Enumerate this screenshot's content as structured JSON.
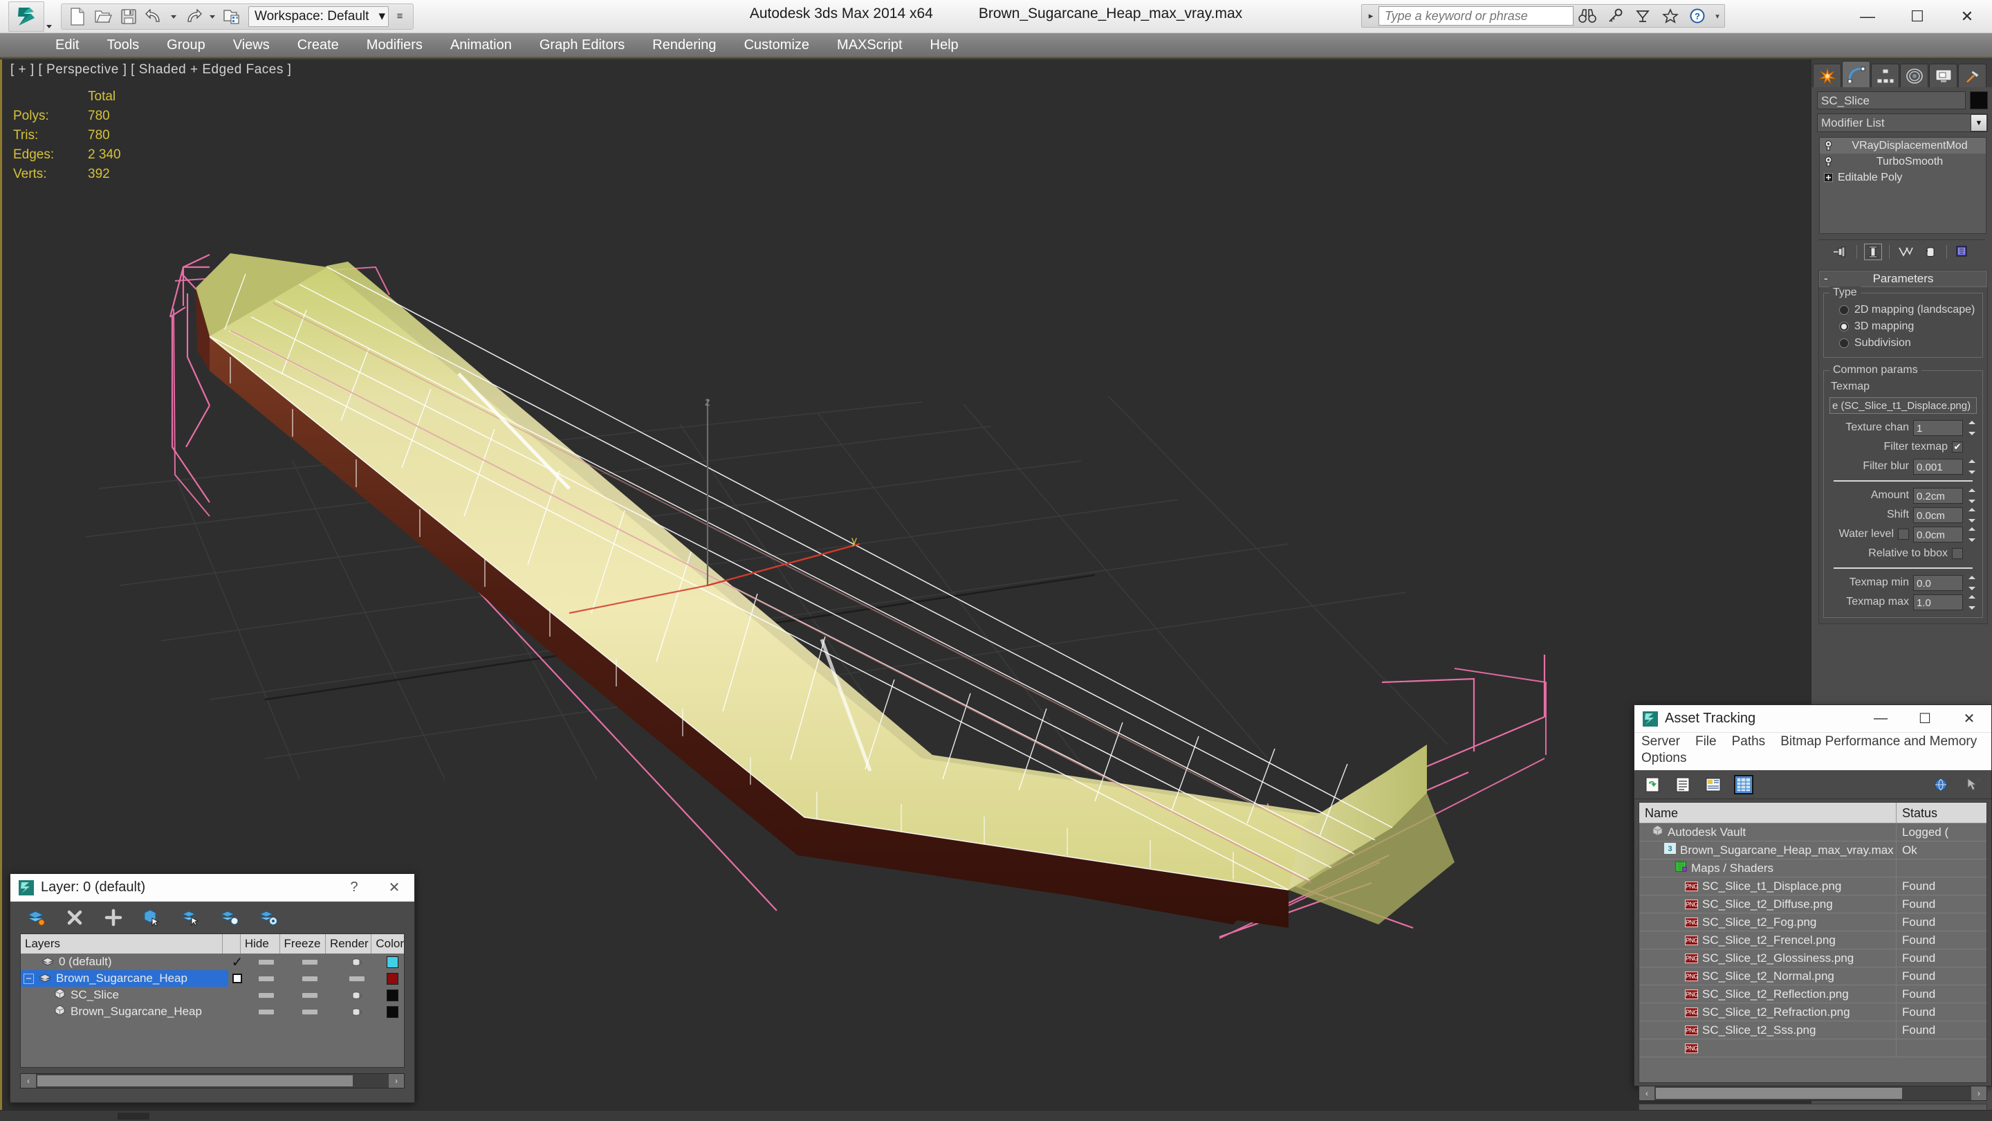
{
  "app": {
    "title": "Autodesk 3ds Max  2014 x64",
    "filename": "Brown_Sugarcane_Heap_max_vray.max",
    "logo_icon": "3dsmax-logo-icon"
  },
  "quick_access": {
    "new_label": "new-file",
    "open_label": "open-file",
    "save_label": "save-file",
    "undo_label": "undo",
    "redo_label": "redo",
    "setproject_label": "set-project-folder",
    "workspace_label": "Workspace: Default",
    "workspace_caret": "▾",
    "more_caret": "≡"
  },
  "search": {
    "placeholder": "Type a keyword or phrase",
    "value": "",
    "arrow": "▸",
    "icons": [
      "binoculars-icon",
      "key-icon",
      "satellite-dish-icon",
      "star-icon",
      "help-icon"
    ],
    "help_caret": "▾"
  },
  "window_controls": {
    "minimize": "—",
    "maximize": "☐",
    "close": "✕"
  },
  "menu": {
    "items": [
      "Edit",
      "Tools",
      "Group",
      "Views",
      "Create",
      "Modifiers",
      "Animation",
      "Graph Editors",
      "Rendering",
      "Customize",
      "MAXScript",
      "Help"
    ]
  },
  "viewport": {
    "label": "[ + ] [ Perspective ] [ Shaded + Edged Faces ]",
    "stats": {
      "header": "Total",
      "rows": [
        {
          "label": "Polys:",
          "value": "780"
        },
        {
          "label": "Tris:",
          "value": "780"
        },
        {
          "label": "Edges:",
          "value": "2 340"
        },
        {
          "label": "Verts:",
          "value": "392"
        }
      ]
    },
    "colors": {
      "background": "#2e2e2e",
      "grid": "#3d3d3d",
      "selection_bracket": "#e86fa6",
      "mesh_top": "#e8e0a0",
      "mesh_side": "#5a2418",
      "wireframe": "#ffffff",
      "axis_x": "#d33a2c",
      "axis_z": "#6a6a6a"
    }
  },
  "command_panel": {
    "tabs": [
      {
        "name": "create",
        "icon": "star-burst-icon",
        "active": false
      },
      {
        "name": "modify",
        "icon": "arc-curve-icon",
        "active": true
      },
      {
        "name": "hierarchy",
        "icon": "hierarchy-icon",
        "active": false
      },
      {
        "name": "motion",
        "icon": "motion-wheel-icon",
        "active": false
      },
      {
        "name": "display",
        "icon": "monitor-icon",
        "active": false
      },
      {
        "name": "utilities",
        "icon": "hammer-icon",
        "active": false
      }
    ],
    "object_name": "SC_Slice",
    "object_color": "#0a0a0a",
    "modifier_list_label": "Modifier List",
    "modifier_stack": [
      {
        "label": "VRayDisplacementMod",
        "icon": "lightbulb-icon",
        "selected": true
      },
      {
        "label": "TurboSmooth",
        "icon": "lightbulb-icon",
        "selected": false
      },
      {
        "label": "Editable Poly",
        "icon": "plus-box-icon",
        "selected": false
      }
    ],
    "stack_tools": [
      "pin-stack-icon",
      "show-end-result-icon",
      "make-unique-icon",
      "remove-modifier-icon",
      "configure-sets-icon"
    ],
    "parameters": {
      "rollout_title": "Parameters",
      "collapse_glyph": "-",
      "type_group": {
        "title": "Type",
        "options": [
          {
            "label": "2D mapping (landscape)",
            "selected": false
          },
          {
            "label": "3D mapping",
            "selected": true
          },
          {
            "label": "Subdivision",
            "selected": false
          }
        ]
      },
      "common_group": {
        "title": "Common params",
        "texmap_label": "Texmap",
        "texmap_value": "e (SC_Slice_t1_Displace.png)",
        "fields": [
          {
            "label": "Texture chan",
            "value": "1",
            "spinner": true
          },
          {
            "label": "Filter texmap",
            "checkbox": true,
            "checked": true
          },
          {
            "label": "Filter blur",
            "value": "0.001",
            "spinner": true
          },
          {
            "label": "Amount",
            "value": "0.2cm",
            "spinner": true
          },
          {
            "label": "Shift",
            "value": "0.0cm",
            "spinner": true
          },
          {
            "label": "Water level",
            "value": "0.0cm",
            "checkbox": true,
            "checked": false,
            "spinner": true
          },
          {
            "label": "Relative to bbox",
            "checkbox": true,
            "checked": false
          },
          {
            "label": "Texmap min",
            "value": "0.0",
            "spinner": true
          },
          {
            "label": "Texmap max",
            "value": "1.0",
            "spinner": true
          }
        ]
      }
    }
  },
  "asset_tracking": {
    "title": "Asset Tracking",
    "icon": "3dsmax-small-icon",
    "window_controls": {
      "minimize": "—",
      "maximize": "☐",
      "close": "✕"
    },
    "menu": [
      "Server",
      "File",
      "Paths",
      "Bitmap Performance and Memory",
      "Options"
    ],
    "toolbar": [
      "refresh-icon",
      "list-view-icon",
      "detail-view-icon",
      "grid-view-icon"
    ],
    "toolbar_right": [
      "globe-help-icon",
      "context-help-icon"
    ],
    "columns": [
      "Name",
      "Status"
    ],
    "rows": [
      {
        "name": "Autodesk Vault",
        "status": "Logged (",
        "icon": "vault-icon",
        "indent": 1
      },
      {
        "name": "Brown_Sugarcane_Heap_max_vray.max",
        "status": "Ok",
        "icon": "max-file-icon",
        "indent": 2
      },
      {
        "name": "Maps / Shaders",
        "status": "",
        "icon": "maps-icon",
        "indent": 3
      },
      {
        "name": "SC_Slice_t1_Displace.png",
        "status": "Found",
        "icon": "png-icon",
        "indent": 4
      },
      {
        "name": "SC_Slice_t2_Diffuse.png",
        "status": "Found",
        "icon": "png-icon",
        "indent": 4
      },
      {
        "name": "SC_Slice_t2_Fog.png",
        "status": "Found",
        "icon": "png-icon",
        "indent": 4
      },
      {
        "name": "SC_Slice_t2_Frencel.png",
        "status": "Found",
        "icon": "png-icon",
        "indent": 4
      },
      {
        "name": "SC_Slice_t2_Glossiness.png",
        "status": "Found",
        "icon": "png-icon",
        "indent": 4
      },
      {
        "name": "SC_Slice_t2_Normal.png",
        "status": "Found",
        "icon": "png-icon",
        "indent": 4
      },
      {
        "name": "SC_Slice_t2_Reflection.png",
        "status": "Found",
        "icon": "png-icon",
        "indent": 4
      },
      {
        "name": "SC_Slice_t2_Refraction.png",
        "status": "Found",
        "icon": "png-icon",
        "indent": 4
      },
      {
        "name": "SC_Slice_t2_Sss.png",
        "status": "Found",
        "icon": "png-icon",
        "indent": 4
      }
    ],
    "scroll": {
      "left_arrow": "‹",
      "right_arrow": "›"
    }
  },
  "layer_dialog": {
    "title": "Layer: 0 (default)",
    "icon": "3dsmax-small-icon",
    "help_glyph": "?",
    "close_glyph": "✕",
    "toolbar": [
      "set-current-layer-icon",
      "delete-layer-icon",
      "add-layer-icon",
      "select-objects-icon",
      "select-highlighted-icon",
      "highlight-selected-icon",
      "layer-properties-icon"
    ],
    "columns": [
      "Layers",
      "",
      "Hide",
      "Freeze",
      "Render",
      "Color"
    ],
    "rows": [
      {
        "name": "0 (default)",
        "icon": "layer-icon",
        "indent": 1,
        "expander": "",
        "current": "✓",
        "hide": "dash",
        "freeze": "dash",
        "render": "teapot",
        "color": "#3fd0e8",
        "selected": false
      },
      {
        "name": "Brown_Sugarcane_Heap",
        "icon": "layer-icon",
        "indent": 0,
        "expander": "⊟",
        "current": "box",
        "hide": "dash",
        "freeze": "dash",
        "render": "dash",
        "color": "#8e0b0b",
        "selected": true
      },
      {
        "name": "SC_Slice",
        "icon": "object-icon",
        "indent": 2,
        "expander": "",
        "current": "",
        "hide": "dash",
        "freeze": "dash",
        "render": "teapot",
        "color": "#0a0a0a",
        "selected": false
      },
      {
        "name": "Brown_Sugarcane_Heap",
        "icon": "object-icon",
        "indent": 2,
        "expander": "",
        "current": "",
        "hide": "dash",
        "freeze": "dash",
        "render": "teapot",
        "color": "#0a0a0a",
        "selected": false
      }
    ],
    "scroll": {
      "left_arrow": "‹",
      "right_arrow": "›"
    }
  }
}
